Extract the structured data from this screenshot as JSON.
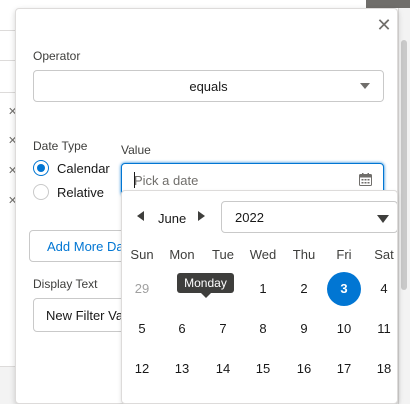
{
  "operator": {
    "label": "Operator",
    "value": "equals"
  },
  "date_type": {
    "label": "Date Type",
    "options": [
      "Calendar",
      "Relative"
    ],
    "selected": "Calendar"
  },
  "add_more_label": "Add More Dates",
  "display_text": {
    "label": "Display Text",
    "value": "New Filter Value"
  },
  "value_field": {
    "label": "Value",
    "placeholder": "Pick a date"
  },
  "datepicker": {
    "month": "June",
    "year": "2022",
    "weekdays": [
      "Sun",
      "Mon",
      "Tue",
      "Wed",
      "Thu",
      "Fri",
      "Sat"
    ],
    "rows": [
      [
        "29",
        "",
        "",
        "1",
        "2",
        "3",
        "4"
      ],
      [
        "5",
        "6",
        "7",
        "8",
        "9",
        "10",
        "11"
      ],
      [
        "12",
        "13",
        "14",
        "15",
        "16",
        "17",
        "18"
      ]
    ],
    "selected_day": "3",
    "tooltip": "Monday"
  },
  "colors": {
    "accent": "#0176d3",
    "tooltip_bg": "#3e3e3c",
    "muted_text": "#a0a0a0"
  }
}
